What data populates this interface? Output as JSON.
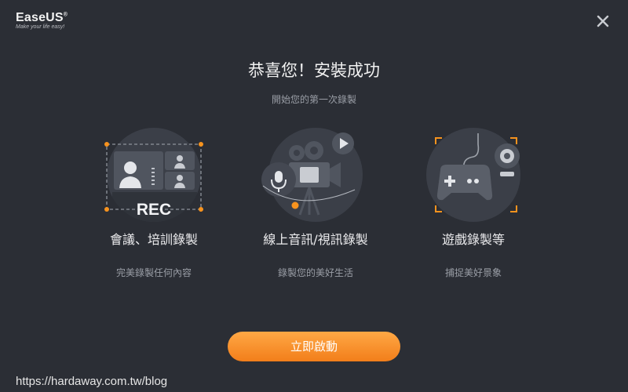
{
  "brand": {
    "name": "EaseUS",
    "reg": "®",
    "tagline": "Make your life easy!"
  },
  "dialog": {
    "title": "恭喜您！安裝成功",
    "subtitle": "開始您的第一次錄製",
    "cards": [
      {
        "title": "會議、培訓錄製",
        "desc": "完美錄製任何內容",
        "badge": "REC",
        "icon": "meeting-record-illustration"
      },
      {
        "title": "線上音訊/視訊錄製",
        "desc": "錄製您的美好生活",
        "icon": "camera-mic-illustration"
      },
      {
        "title": "遊戲錄製等",
        "desc": "捕捉美好景象",
        "icon": "gamepad-webcam-illustration"
      }
    ],
    "start_button": "立即啟動",
    "close_icon": "close-icon"
  },
  "watermark": "https://hardaway.com.tw/blog",
  "colors": {
    "background": "#2b2e35",
    "accent": "#f7931e",
    "circle": "#3b3f48",
    "muted_text": "#9a9ea6"
  }
}
